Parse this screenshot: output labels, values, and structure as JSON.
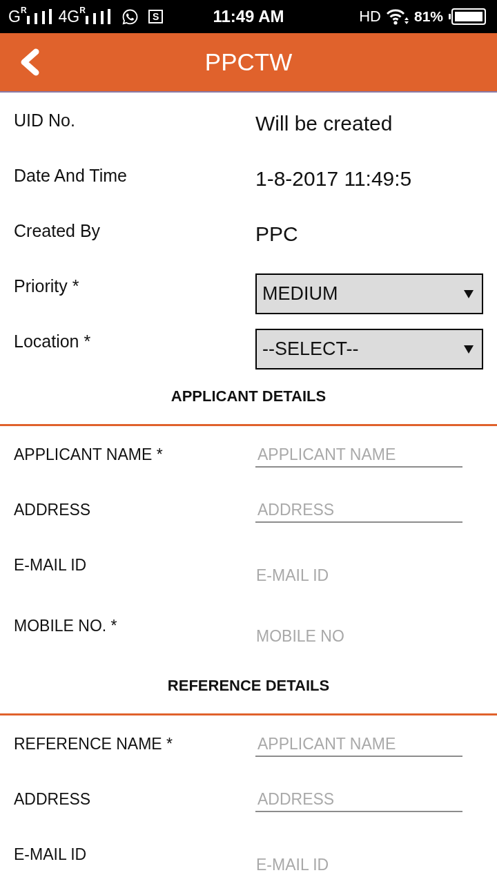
{
  "status_bar": {
    "signals": [
      {
        "network": "G",
        "roaming": "R"
      },
      {
        "network": "4G",
        "roaming": "R"
      }
    ],
    "screenshot_label": "S",
    "time": "11:49 AM",
    "hd": "HD",
    "battery_percent": "81%"
  },
  "header": {
    "title": "PPCTW"
  },
  "rows": [
    {
      "kind": "text",
      "label": "UID No.",
      "value": "Will be created"
    },
    {
      "kind": "text",
      "label": "Date And Time",
      "value": "1-8-2017 11:49:5"
    },
    {
      "kind": "text",
      "label": "Created By",
      "value": "PPC"
    },
    {
      "kind": "select",
      "label": "Priority *",
      "value": "MEDIUM"
    },
    {
      "kind": "select",
      "label": "Location *",
      "value": "--SELECT--"
    }
  ],
  "sections": [
    {
      "title": "APPLICANT DETAILS",
      "fields": [
        {
          "label": "APPLICANT NAME *",
          "placeholder": "APPLICANT NAME",
          "underlined": true
        },
        {
          "label": "ADDRESS",
          "placeholder": "ADDRESS",
          "underlined": true
        },
        {
          "label": "E-MAIL ID",
          "placeholder": "E-MAIL ID",
          "underlined": false
        },
        {
          "label": "MOBILE NO. *",
          "placeholder": "MOBILE NO",
          "underlined": false
        }
      ]
    },
    {
      "title": "REFERENCE DETAILS",
      "fields": [
        {
          "label": "REFERENCE NAME *",
          "placeholder": "APPLICANT NAME",
          "underlined": true
        },
        {
          "label": "ADDRESS",
          "placeholder": "ADDRESS",
          "underlined": true
        },
        {
          "label": "E-MAIL ID",
          "placeholder": "E-MAIL ID",
          "underlined": false
        }
      ]
    }
  ]
}
